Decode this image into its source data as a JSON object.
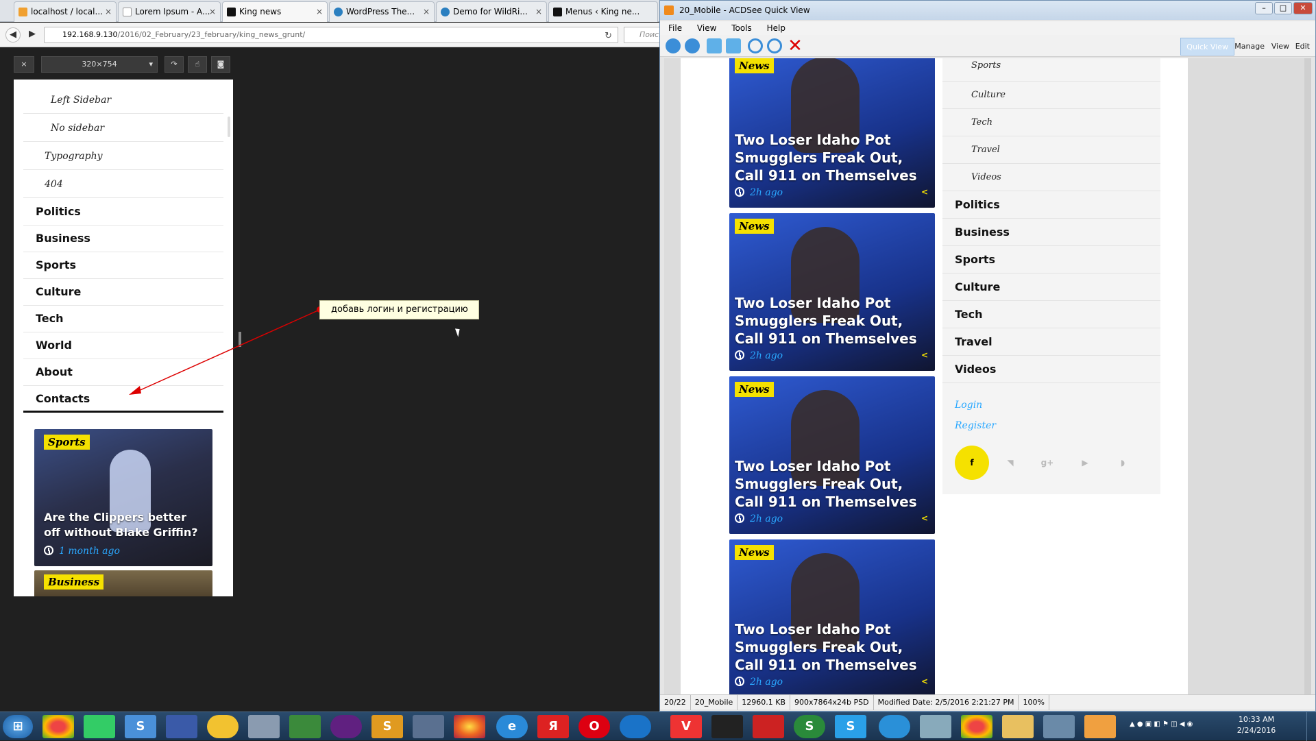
{
  "browser": {
    "tabs": [
      {
        "label": "localhost / local..."
      },
      {
        "label": "Lorem Ipsum - A..."
      },
      {
        "label": "King news"
      },
      {
        "label": "WordPress The..."
      },
      {
        "label": "Demo for WildRi..."
      },
      {
        "label": "Menus ‹ King ne..."
      }
    ],
    "url_host": "192.168.9.130",
    "url_path": "/2016/02_February/23_february/king_news_grunt/",
    "search_placeholder": "Поиск",
    "viewport_size": "320×754",
    "close_glyph": "×",
    "tab_close_glyph": "×"
  },
  "mobile": {
    "submenu": [
      "Left Sidebar",
      "No sidebar"
    ],
    "submenu2": [
      "Typography",
      "404"
    ],
    "menu": [
      "Politics",
      "Business",
      "Sports",
      "Culture",
      "Tech",
      "World",
      "About",
      "Contacts"
    ],
    "cards": [
      {
        "category": "Sports",
        "title": "Are the Clippers better off without Blake Griffin?",
        "time": "1 month ago"
      },
      {
        "category": "Business"
      }
    ]
  },
  "annotation": {
    "text": "добавь логин и регистрацию"
  },
  "acdsee": {
    "title": "20_Mobile - ACDSee Quick View",
    "menu": [
      "File",
      "View",
      "Tools",
      "Help"
    ],
    "right_tabs": [
      "Quick View",
      "Manage",
      "View",
      "Edit"
    ],
    "cards": [
      {
        "category": "News",
        "title": "Two Loser Idaho Pot Smugglers Freak Out, Call 911 on Themselves",
        "time": "2h ago"
      },
      {
        "category": "News",
        "title": "Two Loser Idaho Pot Smugglers Freak Out, Call 911 on Themselves",
        "time": "2h ago"
      },
      {
        "category": "News",
        "title": "Two Loser Idaho Pot Smugglers Freak Out, Call 911 on Themselves",
        "time": "2h ago"
      },
      {
        "category": "News",
        "title": "Two Loser Idaho Pot Smugglers Freak Out, Call 911 on Themselves",
        "time": "2h ago"
      }
    ],
    "sidebar_sub": [
      "Sports",
      "Culture",
      "Tech",
      "Travel",
      "Videos"
    ],
    "sidebar_main": [
      "Politics",
      "Business",
      "Sports",
      "Culture",
      "Tech",
      "Travel",
      "Videos"
    ],
    "login": "Login",
    "register": "Register",
    "social": [
      "f",
      "twitter-icon",
      "g+",
      "youtube-icon",
      "rss-icon"
    ],
    "status": [
      "20/22",
      "20_Mobile",
      "12960.1 KB",
      "900x7864x24b PSD",
      "Modified Date: 2/5/2016 2:21:27 PM",
      "100%"
    ]
  },
  "taskbar": {
    "time": "10:33 AM",
    "date": "2/24/2016"
  },
  "colors": {
    "accent_yellow": "#f5e100",
    "link_blue": "#2aa8ff",
    "annotation_red": "#dd0000"
  }
}
